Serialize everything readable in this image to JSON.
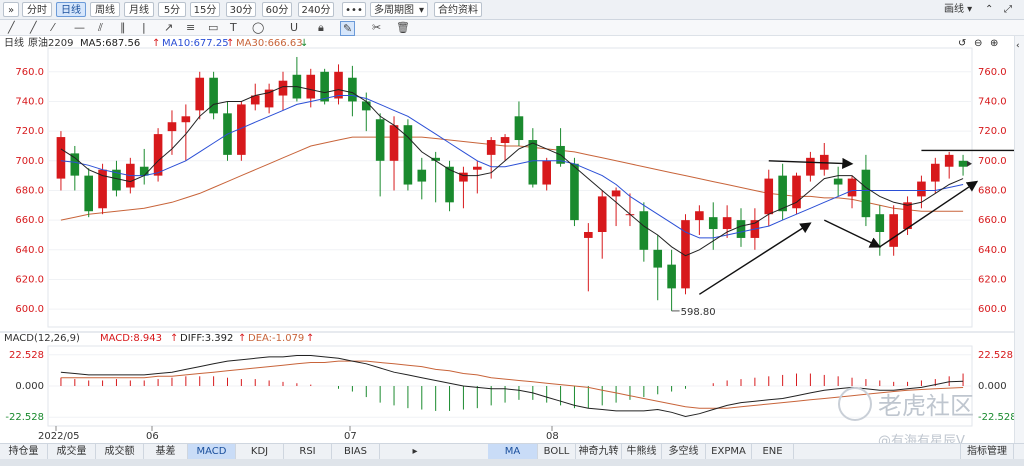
{
  "toolbar": {
    "collapse_icon": "double-chevron-icon",
    "periods": [
      "分时",
      "日线",
      "周线",
      "月线",
      "5分",
      "15分",
      "30分",
      "60分",
      "240分"
    ],
    "active_period": "日线",
    "more": "•••",
    "multi_period": "多周期图",
    "contract_info": "合约资料",
    "chart_type": "画线"
  },
  "info": {
    "period": "日线",
    "symbol": "原油2209",
    "ma5": "MA5:687.56",
    "ma10": "MA10:677.25",
    "ma30": "MA30:666.63"
  },
  "macd_info": {
    "params": "MACD(12,26,9)",
    "macd": "MACD:8.943",
    "diff": "DIFF:3.392",
    "dea": "DEA:-1.079"
  },
  "axes": {
    "price_ticks": [
      "760.0",
      "740.0",
      "720.0",
      "700.0",
      "680.0",
      "660.0",
      "640.0",
      "620.0",
      "600.0"
    ],
    "macd_ticks": [
      "22.528",
      "0.000",
      "-22.528"
    ],
    "date_labels": [
      "2022/05",
      "06",
      "07",
      "08"
    ],
    "low_label": "598.80"
  },
  "tabs": {
    "left": [
      "持仓量",
      "成交量",
      "成交额",
      "基差",
      "MACD",
      "KDJ",
      "RSI",
      "BIAS"
    ],
    "active_left": "MACD",
    "right": [
      "MA",
      "BOLL",
      "神奇九转",
      "牛熊线",
      "多空线",
      "EXPMA",
      "ENE"
    ],
    "active_right": "MA",
    "manage": "指标管理"
  },
  "watermark": {
    "brand": "老虎社区",
    "user": "@有海有星辰V"
  },
  "colors": {
    "up": "#d7191c",
    "down": "#1a8a2e",
    "ma5": "#222222",
    "ma10": "#2b4fd6",
    "ma30": "#c8643a",
    "active_tab": "#c9dcf7"
  },
  "chart_data": {
    "type": "candlestick",
    "ylim": [
      592,
      772
    ],
    "candles": [
      {
        "o": 688,
        "h": 720,
        "l": 680,
        "c": 716
      },
      {
        "o": 705,
        "h": 710,
        "l": 680,
        "c": 690
      },
      {
        "o": 690,
        "h": 695,
        "l": 662,
        "c": 666
      },
      {
        "o": 668,
        "h": 698,
        "l": 664,
        "c": 694
      },
      {
        "o": 694,
        "h": 700,
        "l": 676,
        "c": 680
      },
      {
        "o": 682,
        "h": 702,
        "l": 678,
        "c": 698
      },
      {
        "o": 696,
        "h": 708,
        "l": 684,
        "c": 690
      },
      {
        "o": 690,
        "h": 722,
        "l": 686,
        "c": 718
      },
      {
        "o": 720,
        "h": 734,
        "l": 704,
        "c": 726
      },
      {
        "o": 726,
        "h": 738,
        "l": 700,
        "c": 730
      },
      {
        "o": 734,
        "h": 760,
        "l": 728,
        "c": 756
      },
      {
        "o": 756,
        "h": 760,
        "l": 728,
        "c": 732
      },
      {
        "o": 732,
        "h": 740,
        "l": 700,
        "c": 704
      },
      {
        "o": 704,
        "h": 740,
        "l": 700,
        "c": 738
      },
      {
        "o": 738,
        "h": 752,
        "l": 734,
        "c": 744
      },
      {
        "o": 736,
        "h": 752,
        "l": 732,
        "c": 748
      },
      {
        "o": 744,
        "h": 760,
        "l": 734,
        "c": 754
      },
      {
        "o": 758,
        "h": 770,
        "l": 740,
        "c": 742
      },
      {
        "o": 742,
        "h": 762,
        "l": 736,
        "c": 758
      },
      {
        "o": 760,
        "h": 762,
        "l": 738,
        "c": 740
      },
      {
        "o": 742,
        "h": 765,
        "l": 738,
        "c": 760
      },
      {
        "o": 756,
        "h": 764,
        "l": 730,
        "c": 740
      },
      {
        "o": 740,
        "h": 746,
        "l": 720,
        "c": 734
      },
      {
        "o": 728,
        "h": 732,
        "l": 676,
        "c": 700
      },
      {
        "o": 700,
        "h": 730,
        "l": 680,
        "c": 724
      },
      {
        "o": 724,
        "h": 728,
        "l": 680,
        "c": 684
      },
      {
        "o": 694,
        "h": 702,
        "l": 674,
        "c": 686
      },
      {
        "o": 702,
        "h": 706,
        "l": 672,
        "c": 700
      },
      {
        "o": 696,
        "h": 700,
        "l": 666,
        "c": 672
      },
      {
        "o": 686,
        "h": 696,
        "l": 668,
        "c": 692
      },
      {
        "o": 694,
        "h": 700,
        "l": 678,
        "c": 696
      },
      {
        "o": 704,
        "h": 716,
        "l": 688,
        "c": 714
      },
      {
        "o": 712,
        "h": 718,
        "l": 700,
        "c": 716
      },
      {
        "o": 730,
        "h": 740,
        "l": 710,
        "c": 714
      },
      {
        "o": 714,
        "h": 722,
        "l": 682,
        "c": 684
      },
      {
        "o": 684,
        "h": 702,
        "l": 680,
        "c": 700
      },
      {
        "o": 710,
        "h": 722,
        "l": 696,
        "c": 698
      },
      {
        "o": 698,
        "h": 702,
        "l": 656,
        "c": 660
      },
      {
        "o": 648,
        "h": 658,
        "l": 612,
        "c": 652
      },
      {
        "o": 652,
        "h": 680,
        "l": 634,
        "c": 676
      },
      {
        "o": 676,
        "h": 682,
        "l": 656,
        "c": 680
      },
      {
        "o": 664,
        "h": 678,
        "l": 656,
        "c": 664
      },
      {
        "o": 666,
        "h": 672,
        "l": 632,
        "c": 640
      },
      {
        "o": 640,
        "h": 650,
        "l": 606,
        "c": 628
      },
      {
        "o": 630,
        "h": 640,
        "l": 598.8,
        "c": 614
      },
      {
        "o": 614,
        "h": 664,
        "l": 610,
        "c": 660
      },
      {
        "o": 660,
        "h": 670,
        "l": 650,
        "c": 666
      },
      {
        "o": 662,
        "h": 672,
        "l": 640,
        "c": 654
      },
      {
        "o": 654,
        "h": 670,
        "l": 648,
        "c": 662
      },
      {
        "o": 660,
        "h": 668,
        "l": 642,
        "c": 648
      },
      {
        "o": 648,
        "h": 668,
        "l": 640,
        "c": 660
      },
      {
        "o": 664,
        "h": 694,
        "l": 656,
        "c": 688
      },
      {
        "o": 690,
        "h": 698,
        "l": 660,
        "c": 666
      },
      {
        "o": 668,
        "h": 692,
        "l": 664,
        "c": 690
      },
      {
        "o": 690,
        "h": 706,
        "l": 686,
        "c": 702
      },
      {
        "o": 694,
        "h": 712,
        "l": 690,
        "c": 704
      },
      {
        "o": 688,
        "h": 696,
        "l": 676,
        "c": 684
      },
      {
        "o": 676,
        "h": 690,
        "l": 668,
        "c": 688
      },
      {
        "o": 694,
        "h": 704,
        "l": 656,
        "c": 662
      },
      {
        "o": 664,
        "h": 670,
        "l": 636,
        "c": 652
      },
      {
        "o": 642,
        "h": 670,
        "l": 636,
        "c": 664
      },
      {
        "o": 654,
        "h": 676,
        "l": 650,
        "c": 672
      },
      {
        "o": 676,
        "h": 690,
        "l": 668,
        "c": 686
      },
      {
        "o": 686,
        "h": 702,
        "l": 678,
        "c": 698
      },
      {
        "o": 696,
        "h": 706,
        "l": 688,
        "c": 704
      },
      {
        "o": 700,
        "h": 704,
        "l": 690,
        "c": 696
      }
    ],
    "ma5": [
      708,
      702,
      694,
      690,
      688,
      686,
      690,
      700,
      708,
      718,
      730,
      738,
      740,
      740,
      744,
      746,
      750,
      750,
      748,
      746,
      748,
      746,
      740,
      730,
      724,
      716,
      706,
      700,
      694,
      690,
      690,
      692,
      700,
      708,
      712,
      708,
      704,
      696,
      688,
      680,
      672,
      664,
      656,
      650,
      642,
      636,
      640,
      646,
      652,
      656,
      658,
      664,
      668,
      672,
      680,
      688,
      690,
      690,
      682,
      676,
      672,
      670,
      672,
      678,
      684,
      688
    ],
    "ma10": [
      700,
      699,
      697,
      694,
      692,
      690,
      690,
      692,
      696,
      700,
      706,
      712,
      718,
      722,
      726,
      730,
      734,
      738,
      740,
      742,
      744,
      744,
      742,
      738,
      734,
      730,
      724,
      718,
      712,
      706,
      700,
      696,
      696,
      698,
      700,
      700,
      700,
      698,
      694,
      690,
      684,
      676,
      670,
      664,
      658,
      652,
      648,
      648,
      650,
      652,
      654,
      656,
      660,
      664,
      668,
      672,
      676,
      680,
      680,
      680,
      680,
      680,
      680,
      680,
      682,
      684
    ],
    "ma30": [
      660,
      662,
      664,
      665,
      666,
      667,
      668,
      670,
      672,
      675,
      678,
      682,
      686,
      690,
      694,
      698,
      702,
      706,
      710,
      712,
      714,
      716,
      716,
      716,
      716,
      716,
      716,
      715,
      714,
      713,
      712,
      711,
      710,
      710,
      709,
      708,
      707,
      706,
      704,
      702,
      700,
      698,
      696,
      694,
      692,
      690,
      688,
      686,
      684,
      682,
      680,
      678,
      677,
      676,
      676,
      675,
      675,
      674,
      672,
      670,
      668,
      667,
      666,
      666,
      666,
      666
    ],
    "macd_ylim": [
      -26,
      26
    ],
    "macd_hist": [
      6,
      5,
      4,
      4,
      5,
      4,
      4,
      5,
      6,
      7,
      7,
      7,
      6,
      5,
      5,
      4,
      3,
      2,
      1,
      0,
      -2,
      -4,
      -8,
      -12,
      -14,
      -16,
      -17,
      -18,
      -18,
      -17,
      -16,
      -14,
      -12,
      -10,
      -10,
      -12,
      -14,
      -16,
      -16,
      -14,
      -12,
      -10,
      -8,
      -6,
      -4,
      -2,
      0,
      2,
      4,
      5,
      6,
      7,
      8,
      9,
      9,
      8,
      7,
      6,
      5,
      4,
      3,
      3,
      4,
      5,
      7,
      9
    ],
    "diff": [
      10,
      9,
      8,
      8,
      8,
      8,
      8,
      9,
      10,
      12,
      14,
      16,
      18,
      19,
      20,
      21,
      21,
      22,
      22,
      21,
      20,
      18,
      16,
      13,
      10,
      8,
      6,
      4,
      2,
      0,
      -1,
      -2,
      -2,
      -3,
      -5,
      -8,
      -11,
      -14,
      -16,
      -17,
      -18,
      -18,
      -18,
      -17,
      -19,
      -22,
      -20,
      -17,
      -14,
      -12,
      -11,
      -10,
      -9,
      -7,
      -5,
      -3,
      -2,
      -1,
      -2,
      -3,
      -3,
      -2,
      -1,
      1,
      3,
      3.4
    ],
    "dea": [
      6,
      6,
      6,
      6,
      6,
      6,
      6,
      7,
      7,
      8,
      9,
      10,
      11,
      12,
      13,
      14,
      15,
      16,
      17,
      17,
      18,
      18,
      18,
      17,
      16,
      15,
      14,
      12,
      11,
      9,
      8,
      6,
      5,
      4,
      3,
      2,
      1,
      0,
      -1,
      -3,
      -5,
      -7,
      -9,
      -11,
      -13,
      -15,
      -16,
      -16,
      -16,
      -15,
      -14,
      -13,
      -12,
      -11,
      -10,
      -9,
      -8,
      -7,
      -6,
      -5,
      -4,
      -3,
      -2.5,
      -2,
      -1.5,
      -1.1
    ]
  }
}
